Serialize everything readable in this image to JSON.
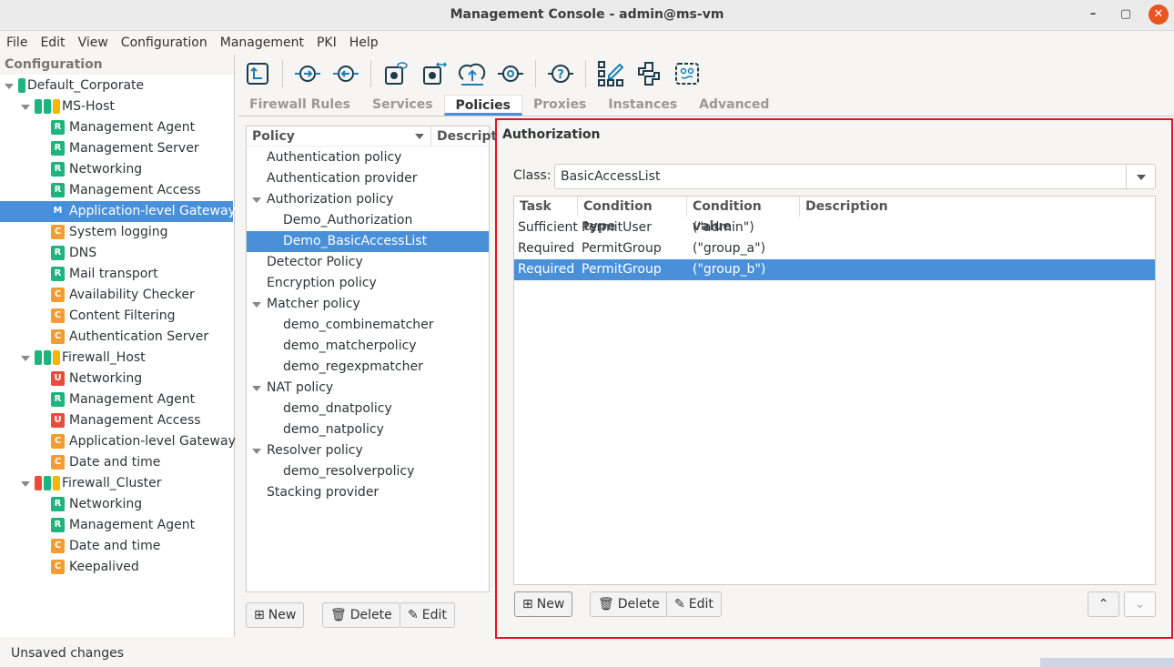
{
  "window": {
    "title": "Management Console - admin@ms-vm",
    "controls": [
      "–",
      "▢",
      "✕"
    ]
  },
  "menu": [
    "File",
    "Edit",
    "View",
    "Configuration",
    "Management",
    "PKI",
    "Help"
  ],
  "left": {
    "header": "Configuration",
    "tree": [
      {
        "label": "Default_Corporate",
        "level": 0,
        "bars": [
          "#1db47e"
        ],
        "expanded": true
      },
      {
        "label": "MS-Host",
        "level": 1,
        "bars": [
          "#1db47e",
          "#1db47e",
          "#f5b800"
        ],
        "expanded": true
      },
      {
        "label": "Management Agent",
        "level": 2,
        "badge": "R"
      },
      {
        "label": "Management Server",
        "level": 2,
        "badge": "R"
      },
      {
        "label": "Networking",
        "level": 2,
        "badge": "R"
      },
      {
        "label": "Management Access",
        "level": 2,
        "badge": "R"
      },
      {
        "label": "Application-level Gateway",
        "level": 2,
        "badge": "M",
        "selected": true
      },
      {
        "label": "System logging",
        "level": 2,
        "badge": "C"
      },
      {
        "label": "DNS",
        "level": 2,
        "badge": "R"
      },
      {
        "label": "Mail transport",
        "level": 2,
        "badge": "R"
      },
      {
        "label": "Availability Checker",
        "level": 2,
        "badge": "C"
      },
      {
        "label": "Content Filtering",
        "level": 2,
        "badge": "C"
      },
      {
        "label": "Authentication Server",
        "level": 2,
        "badge": "C"
      },
      {
        "label": "Firewall_Host",
        "level": 1,
        "bars": [
          "#1db47e",
          "#1db47e",
          "#f5b800"
        ],
        "expanded": true
      },
      {
        "label": "Networking",
        "level": 2,
        "badge": "U"
      },
      {
        "label": "Management Agent",
        "level": 2,
        "badge": "R"
      },
      {
        "label": "Management Access",
        "level": 2,
        "badge": "U"
      },
      {
        "label": "Application-level Gateway",
        "level": 2,
        "badge": "C"
      },
      {
        "label": "Date and time",
        "level": 2,
        "badge": "C"
      },
      {
        "label": "Firewall_Cluster",
        "level": 1,
        "bars": [
          "#e74c3c",
          "#1db47e",
          "#f5b800"
        ],
        "expanded": true
      },
      {
        "label": "Networking",
        "level": 2,
        "badge": "R"
      },
      {
        "label": "Management Agent",
        "level": 2,
        "badge": "R"
      },
      {
        "label": "Date and time",
        "level": 2,
        "badge": "C"
      },
      {
        "label": "Keepalived",
        "level": 2,
        "badge": "C"
      }
    ]
  },
  "badge_colors": {
    "R": "#1db47e",
    "C": "#f39c33",
    "U": "#e74c3c",
    "M": "#3d8ee0"
  },
  "toolbar": [
    "upload-config-icon",
    "connect-icon",
    "disconnect-icon",
    "view-config-icon",
    "transfer-config-icon",
    "cloud-upload-icon",
    "service-icon",
    "help-icon",
    "edit-grid-icon",
    "python-icon",
    "terminal-icon"
  ],
  "tabs": [
    {
      "label": "Firewall Rules"
    },
    {
      "label": "Services"
    },
    {
      "label": "Policies",
      "active": true
    },
    {
      "label": "Proxies"
    },
    {
      "label": "Instances"
    },
    {
      "label": "Advanced"
    }
  ],
  "policies": {
    "col_policy": "Policy",
    "col_desc": "Descript",
    "items": [
      {
        "label": "Authentication policy",
        "level": 0
      },
      {
        "label": "Authentication provider",
        "level": 0
      },
      {
        "label": "Authorization policy",
        "level": 0,
        "expanded": true
      },
      {
        "label": "Demo_Authorization",
        "level": 1
      },
      {
        "label": "Demo_BasicAccessList",
        "level": 1,
        "selected": true
      },
      {
        "label": "Detector Policy",
        "level": 0
      },
      {
        "label": "Encryption policy",
        "level": 0
      },
      {
        "label": "Matcher policy",
        "level": 0,
        "expanded": true
      },
      {
        "label": "demo_combinematcher",
        "level": 1
      },
      {
        "label": "demo_matcherpolicy",
        "level": 1
      },
      {
        "label": "demo_regexpmatcher",
        "level": 1
      },
      {
        "label": "NAT policy",
        "level": 0,
        "expanded": true
      },
      {
        "label": "demo_dnatpolicy",
        "level": 1
      },
      {
        "label": "demo_natpolicy",
        "level": 1
      },
      {
        "label": "Resolver policy",
        "level": 0,
        "expanded": true
      },
      {
        "label": "demo_resolverpolicy",
        "level": 1
      },
      {
        "label": "Stacking provider",
        "level": 0
      }
    ],
    "new": "New",
    "delete": "Delete",
    "edit": "Edit"
  },
  "auth": {
    "title": "Authorization",
    "class_label": "Class:",
    "class_value": "BasicAccessList",
    "columns": [
      "Task",
      "Condition type",
      "Condition value",
      "Description"
    ],
    "rows": [
      [
        "Sufficient",
        "PermitUser",
        "(\"admin\")",
        ""
      ],
      [
        "Required",
        "PermitGroup",
        "(\"group_a\")",
        ""
      ],
      [
        "Required",
        "PermitGroup",
        "(\"group_b\")",
        ""
      ]
    ],
    "selected_row": 2,
    "new": "New",
    "delete": "Delete",
    "edit": "Edit"
  },
  "status": "Unsaved changes"
}
